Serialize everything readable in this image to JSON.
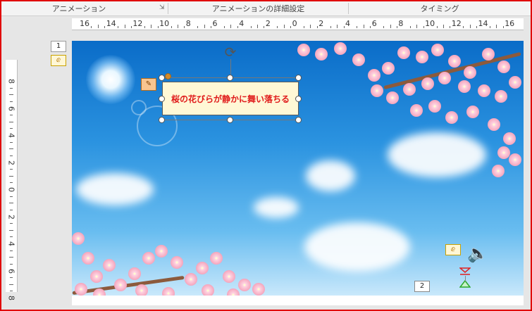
{
  "ribbon": {
    "group1_label": "アニメーション",
    "group2_label": "アニメーションの詳細設定",
    "group3_label": "タイミング",
    "launcher_glyph": "⇲"
  },
  "ruler_h": {
    "labels": [
      "16",
      "14",
      "12",
      "10",
      "8",
      "6",
      "4",
      "2",
      "0",
      "2",
      "4",
      "6",
      "8",
      "10",
      "12",
      "14",
      "16"
    ]
  },
  "ruler_v": {
    "labels": [
      "8",
      "6",
      "4",
      "2",
      "0",
      "2",
      "4",
      "6",
      "8"
    ]
  },
  "sidebar": {
    "slide_number": "1",
    "anim_glyph": "ⅇ"
  },
  "slide": {
    "textbox_text": "桜の花びらが静かに舞い落ちる",
    "anim_tag_glyph": "✎",
    "order_number": "2",
    "audio_anim_glyph": "ⅇ",
    "speaker_glyph": "🔈"
  },
  "colors": {
    "frame": "#e00000",
    "text_red": "#e01a1a",
    "textbox_bg": "#fff8d6"
  }
}
